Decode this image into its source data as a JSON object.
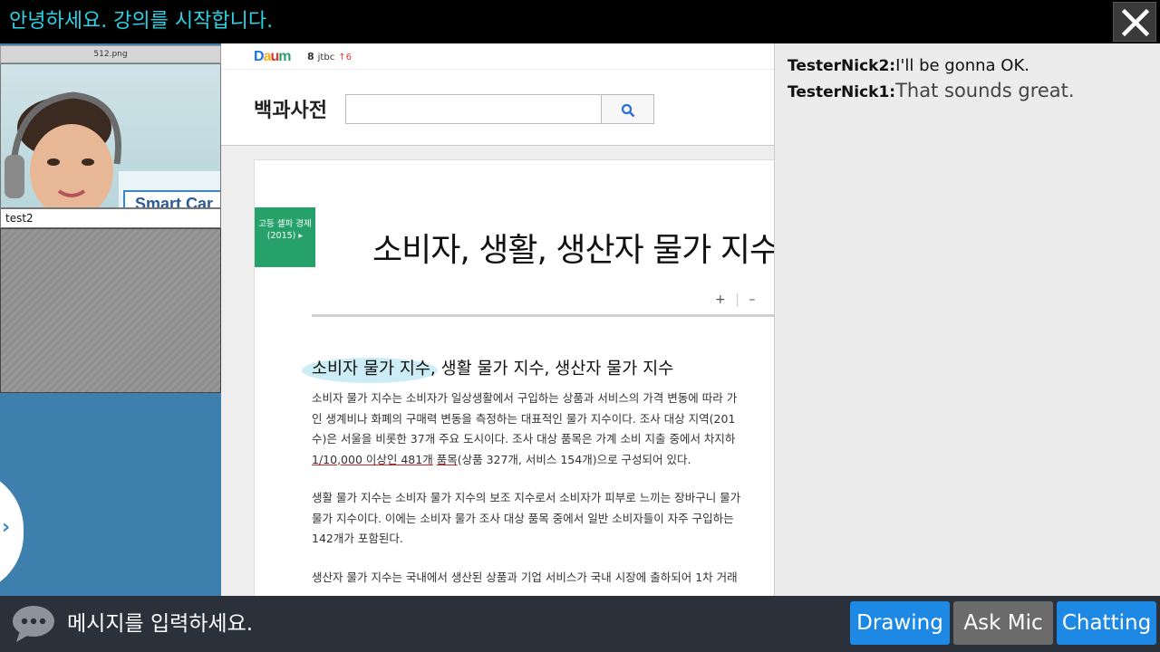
{
  "header": {
    "title": "안녕하세요. 강의를 시작합니다."
  },
  "video_panel": {
    "top_label": "512.png",
    "user_label": "test2",
    "expand_glyph": "›"
  },
  "webpage": {
    "logo": "Daum",
    "trend_rank": "8",
    "trend_keyword": "jtbc",
    "trend_change": "↑6",
    "dict_title": "백과사전",
    "search_value": "",
    "category_badge": "고등 셀파 경제(2015)",
    "category_arrow": "▸",
    "article_title": "소비자, 생활, 생산자 물가 지수",
    "zoom_plus": "+",
    "zoom_sep": "|",
    "zoom_minus": "–",
    "section_heading": "소비자 물가 지수, 생활 물가 지수, 생산자 물가 지수",
    "para1": [
      "소비자 물가 지수는 소비자가 일상생활에서 구입하는 상품과 서비스의 가격 변동에 따라 가",
      "인 생계비나 화폐의 구매력 변동을 측정하는 대표적인 물가 지수이다. 조사 대상 지역(201",
      "수)은 서울을 비롯한 37개 주요 도시이다. 조사 대상 품목은 가계 소비 지출 중에서 차지하"
    ],
    "para1_last_red": "1/10,000 이상인 481개",
    "para1_last_red2": "품목",
    "para1_last_rest": "(상품 327개, 서비스 154개)으로 구성되어 있다.",
    "para2": [
      "생활 물가 지수는 소비자 물가 지수의 보조 지수로서 소비자가 피부로 느끼는 장바구니 물가",
      "물가 지수이다. 이에는 소비자 물가 조사 대상 품목 중에서 일반 소비자들이 자주 구입하는",
      "142개가 포함된다."
    ],
    "para3": [
      "생산자 물가 지수는 국내에서 생산된 상품과 기업 서비스가 국내 시장에 출하되어 1차 거래"
    ]
  },
  "chat": {
    "messages": [
      {
        "nick": "TesterNick2:",
        "text": "I'll be gonna OK."
      },
      {
        "nick": "TesterNick1:",
        "text": "That sounds great."
      }
    ]
  },
  "bottom": {
    "input_placeholder": "메시지를 입력하세요.",
    "drawing_label": "Drawing",
    "ask_mic_label": "Ask Mic",
    "chatting_label": "Chatting"
  },
  "colors": {
    "title_text": "#2ad3e6",
    "button_blue": "#1e88e5",
    "button_gray": "#6b6b6b",
    "badge_green": "#27a16a",
    "bottom_bar": "#2b313b"
  }
}
